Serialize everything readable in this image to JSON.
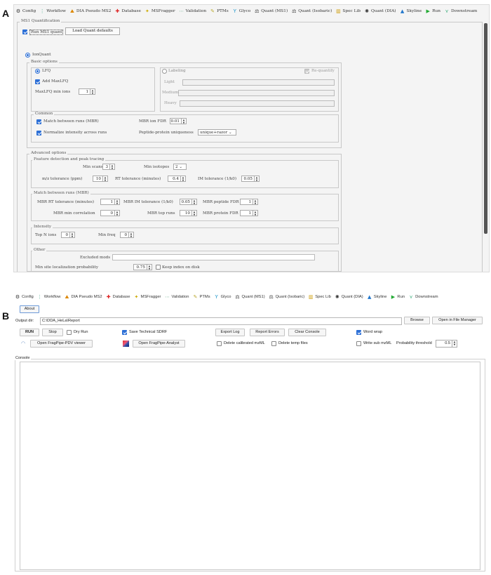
{
  "panel_labels": {
    "a": "A",
    "b": "B"
  },
  "tabs": [
    {
      "icon": "config-icon",
      "glyph": "⚙",
      "label": "Config"
    },
    {
      "icon": "workflow-icon",
      "glyph": "⋮",
      "label": "Workflow"
    },
    {
      "icon": "dia-pseudo-icon",
      "glyph": "⛰",
      "label": "DIA Pseudo MS2"
    },
    {
      "icon": "database-icon",
      "glyph": "✚",
      "label": "Database"
    },
    {
      "icon": "msfragger-icon",
      "glyph": "✦",
      "label": "MSFragger"
    },
    {
      "icon": "validation-icon",
      "glyph": "⋯",
      "label": "Validation"
    },
    {
      "icon": "ptms-icon",
      "glyph": "✎",
      "label": "PTMs"
    },
    {
      "icon": "glyco-icon",
      "glyph": "Y",
      "label": "Glyco"
    },
    {
      "icon": "quant-ms1-icon",
      "glyph": "⚖",
      "label": "Quant (MS1)"
    },
    {
      "icon": "quant-isobaric-icon",
      "glyph": "⚖",
      "label": "Quant (Isobaric)"
    },
    {
      "icon": "spec-lib-icon",
      "glyph": "▥",
      "label": "Spec Lib"
    },
    {
      "icon": "quant-dia-icon",
      "glyph": "✺",
      "label": "Quant (DIA)"
    },
    {
      "icon": "skyline-icon",
      "glyph": "▲",
      "label": "Skyline"
    },
    {
      "icon": "run-icon",
      "glyph": "▶",
      "label": "Run"
    },
    {
      "icon": "downstream-icon",
      "glyph": "⋎",
      "label": "Downstream"
    }
  ],
  "panelA": {
    "section_title": "MS1 Quantification",
    "run_ms1_quant": "Run MS1 quant",
    "load_defaults": "Load Quant defaults",
    "ionquant": "IonQuant",
    "basic_options": "Basic options",
    "lfq": "LFQ",
    "add_maxlfq": "Add MaxLFQ",
    "maxlfq_min_ions_label": "MaxLFQ min ions",
    "maxlfq_min_ions": "1",
    "labeling": "Labeling",
    "requantify": "Re-quantify",
    "light": "Light",
    "medium": "Medium",
    "heavy": "Heavy",
    "common": "Common",
    "mbr": "Match between runs (MBR)",
    "mbr_ion_fdr_label": "MBR ion FDR",
    "mbr_ion_fdr": "0.01",
    "normalize": "Normalize intensity across runs",
    "uniqueness_label": "Peptide-protein uniqueness",
    "uniqueness": "unique+razor",
    "advanced_options": "Advanced options",
    "feature_detection": "Feature detection and peak tracing",
    "min_scans_label": "Min scans",
    "min_scans": "3",
    "min_isotopes_label": "Min isotopes",
    "min_isotopes": "2",
    "mz_tol_label": "m/z tolerance (ppm)",
    "mz_tol": "10",
    "rt_tol_label": "RT tolerance (minutes)",
    "rt_tol": "0.4",
    "im_tol_label": "IM tolerance (1/k0)",
    "im_tol": "0.05",
    "mbr_section": "Match between runs (MBR)",
    "mbr_rt_tol_label": "MBR RT tolerance (minutes)",
    "mbr_rt_tol": "1",
    "mbr_im_tol_label": "MBR IM tolerance (1/k0)",
    "mbr_im_tol": "0.05",
    "mbr_pep_fdr_label": "MBR peptide FDR",
    "mbr_pep_fdr": "1",
    "mbr_min_corr_label": "MBR min correlation",
    "mbr_min_corr": "0",
    "mbr_top_runs_label": "MBR top runs",
    "mbr_top_runs": "10",
    "mbr_prot_fdr_label": "MBR protein FDR",
    "mbr_prot_fdr": "1",
    "intensity": "Intensity",
    "top_n_label": "Top N ions",
    "top_n": "0",
    "min_freq_label": "Min freq",
    "min_freq": "0",
    "other": "Other",
    "excluded_mods_label": "Excluded mods",
    "min_site_label": "Min site localization probability",
    "min_site": "0.75",
    "keep_index": "Keep index on disk"
  },
  "panelB": {
    "about": "About",
    "output_dir_label": "Output dir:",
    "output_dir": "C:\\DDA_HeLa\\Report",
    "browse": "Browse",
    "open_fm": "Open in File Manager",
    "run": "RUN",
    "stop": "Stop",
    "dry_run": "Dry Run",
    "save_sdrf": "Save Technical SDRF",
    "export_log": "Export Log",
    "report_errors": "Report Errors",
    "clear_console": "Clear Console",
    "word_wrap": "Word wrap",
    "pdv_viewer": "Open FragPipe-PDV viewer",
    "analyst": "Open FragPipe-Analyst",
    "delete_mzml": "Delete calibrated mzML",
    "delete_temp": "Delete temp files",
    "write_sub": "Write sub mzML",
    "prob_thresh_label": "Probability threshold",
    "prob_thresh": "0.5",
    "console": "Console"
  }
}
